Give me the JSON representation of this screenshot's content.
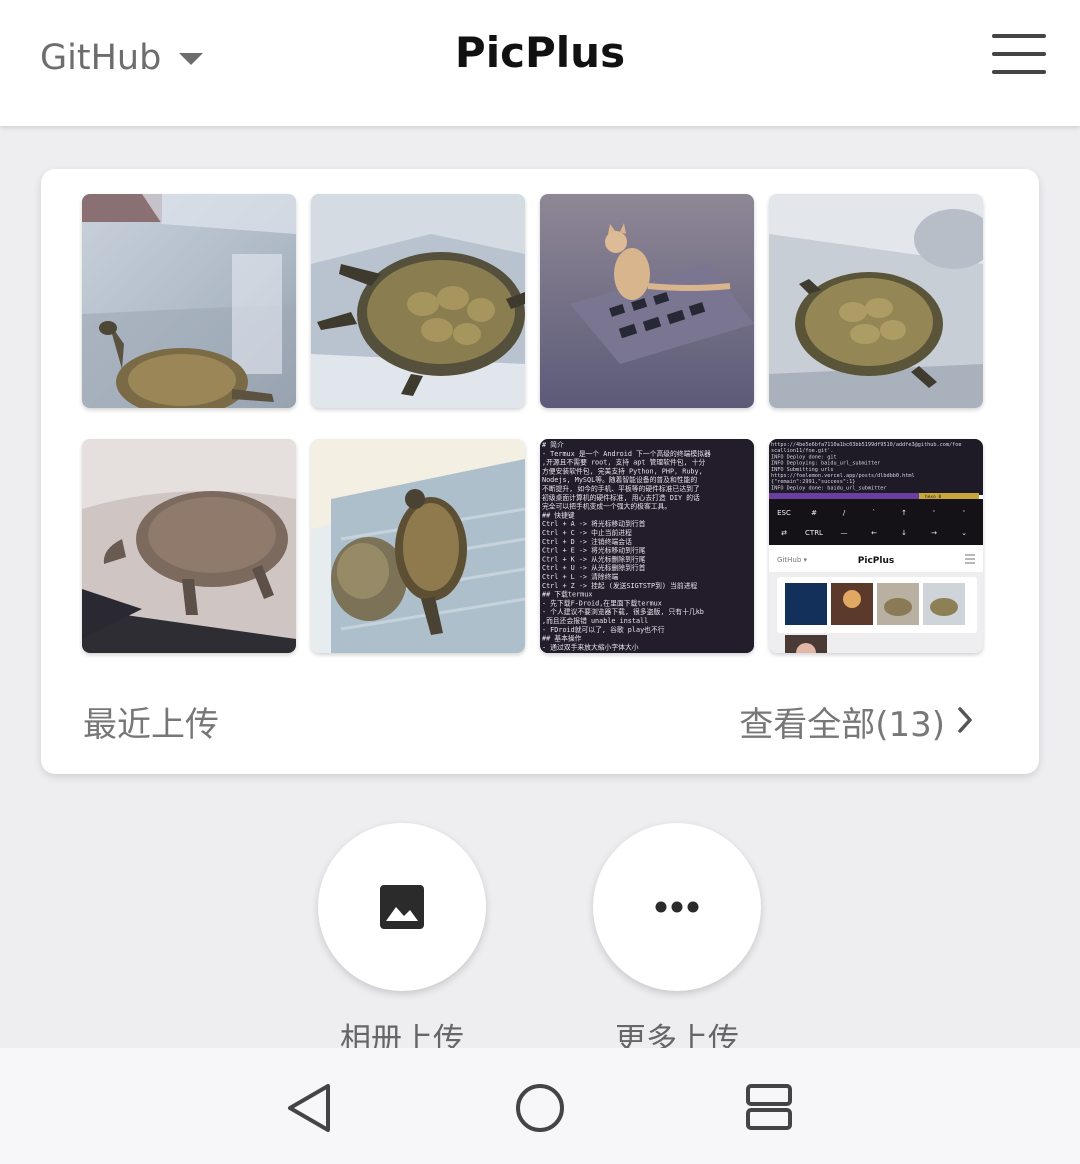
{
  "header": {
    "account_label": "GitHub",
    "account_icon": "caret-down-icon",
    "title": "PicPlus",
    "menu_icon": "hamburger-menu-icon"
  },
  "recent": {
    "section_label": "最近上传",
    "view_all_label": "查看全部(13)",
    "view_all_icon": "chevron-right-icon",
    "photos": [
      "turtle-in-plastic-box-photo",
      "turtle-in-water-tub-photo",
      "cat-on-drain-grate-photo",
      "turtle-in-basin-photo",
      "turtle-behind-glass-photo",
      "two-turtles-on-tray-photo",
      "termux-notes-screenshot",
      "termux-picplus-screenshot"
    ]
  },
  "termux_note_lines": [
    "# 简介",
    "- Termux 是一个 Android 下一个高级的终端模拟器",
    ",开源且不需要 root, 支持 apt 管理软件包, 十分",
    "方便安装软件包, 完美支持 Python, PHP, Ruby,",
    "Nodejs, MySQL等。随着智能设备的普及和性能的",
    "不断提升, 如今的手机、平板等的硬件标准已达到了",
    "初级桌面计算机的硬件标准, 用心去打造 DIY 的话",
    "完全可以把手机变成一个强大的极客工具。",
    "## 快捷键",
    "Ctrl + A -> 将光标移动到行首",
    "Ctrl + C -> 中止当前进程",
    "Ctrl + D -> 注销终端会话",
    "Ctrl + E -> 将光标移动到行尾",
    "Ctrl + K -> 从光标删除到行尾",
    "Ctrl + U -> 从光标删除到行首",
    "Ctrl + L -> 清除终端",
    "Ctrl + Z -> 挂起 (发送SIGTSTP到) 当前进程",
    "## 下载termux",
    "- 先下载F-Droid,在里面下载termux",
    "- 个人建议不要浏览器下载, 很多盗版, 只有十几kb",
    ",而且还会报错 unable install",
    "- FDroid就可以了, 谷歌 play也不行",
    "## 基本操作",
    "- 通过双手来放大缩小字体大小"
  ],
  "termux_shot": {
    "log_lines": [
      "https://4be5e6bfa7110a1bc03bb5199df9510/addfe3@github.com/foe",
      "scallion11/foe.git'.",
      "INFO  Deploy done: git",
      "INFO  Deploying: baidu_url_submitter",
      "INFO  Submitting urls",
      "https://foelemon.vercel.app/posts/dlbdbb0.html",
      "{\"remain\":2991,\"success\":1}",
      "INFO  Deploy done: baidu_url_submitter"
    ],
    "status_label": "hexo 0",
    "keys_row1": [
      "ESC",
      "#",
      "/",
      "`",
      "↑",
      "'",
      "'"
    ],
    "keys_row2": [
      "⇄",
      "CTRL",
      "—",
      "←",
      "↓",
      "→",
      "⌄"
    ],
    "mini_account": "GitHub ▾",
    "mini_title": "PicPlus"
  },
  "actions": {
    "album_upload_label": "相册上传",
    "album_upload_icon": "image-icon",
    "more_upload_label": "更多上传",
    "more_upload_icon": "more-dots-icon"
  },
  "navbar": {
    "back_icon": "back-triangle-icon",
    "home_icon": "home-circle-icon",
    "recents_icon": "recents-square-icon"
  }
}
